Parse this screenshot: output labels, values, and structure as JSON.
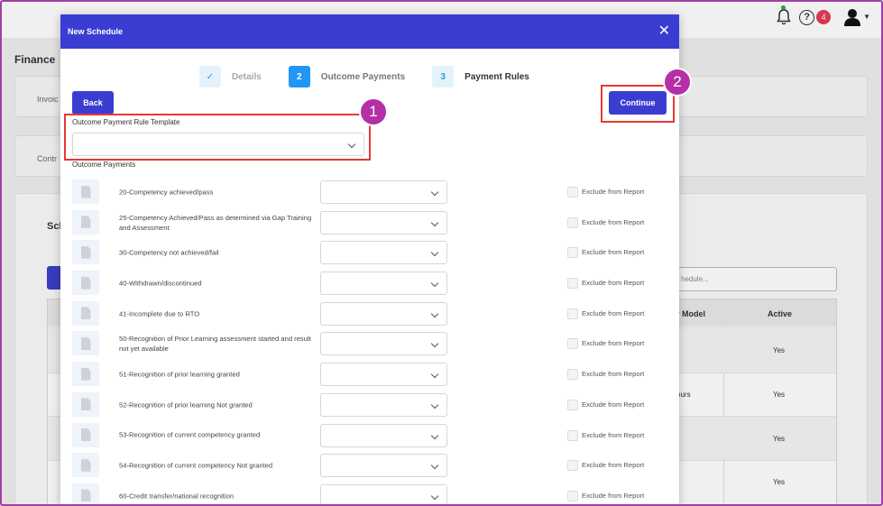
{
  "topbar": {
    "notification_count": "4",
    "help_glyph": "?",
    "icons": [
      "bell-icon",
      "help-icon",
      "user-icon",
      "caret-down-icon"
    ]
  },
  "background": {
    "page_title": "Finance",
    "card1_label": "Invoic",
    "card2_label": "Contr",
    "section_title": "Sch",
    "search_placeholder": "hedule...",
    "table_headers": {
      "model": "r Model",
      "active": "Active"
    },
    "table_rows": [
      {
        "model": "",
        "active": "Yes"
      },
      {
        "model": "ours",
        "active": "Yes"
      },
      {
        "model": "",
        "active": "Yes"
      },
      {
        "model": "",
        "active": "Yes"
      }
    ]
  },
  "modal": {
    "title": "New Schedule",
    "close_glyph": "✕",
    "steps": [
      {
        "num": "✓",
        "label": "Details",
        "state": "done"
      },
      {
        "num": "2",
        "label": "Outcome Payments",
        "state": "active"
      },
      {
        "num": "3",
        "label": "Payment Rules",
        "state": "next"
      }
    ],
    "back_label": "Back",
    "continue_label": "Continue",
    "template_label": "Outcome Payment Rule Template",
    "template_value": "",
    "outcome_payments_label": "Outcome Payments",
    "exclude_label": "Exclude from Report",
    "rows": [
      {
        "label": "20-Competency achieved/pass"
      },
      {
        "label": "25-Competency Achieved/Pass as determined via Gap Training and Assessment"
      },
      {
        "label": "30-Competency not achieved/fail"
      },
      {
        "label": "40-Withdrawn/discontinued"
      },
      {
        "label": "41-Incomplete due to RTO"
      },
      {
        "label": "50-Recognition of Prior Learning assessment started and result not yet available"
      },
      {
        "label": "51-Recognition of prior learning granted"
      },
      {
        "label": "52-Recognition of prior learning Not granted"
      },
      {
        "label": "53-Recognition of current competency granted"
      },
      {
        "label": "54-Recognition of current competency Not granted"
      },
      {
        "label": "60-Credit transfer/national recognition"
      }
    ]
  },
  "annotations": {
    "badge1": "1",
    "badge2": "2",
    "highlight_color": "#e53935",
    "badge_color": "#b52fa7"
  },
  "colors": {
    "primary": "#3b3dd2",
    "step_active": "#2196f3",
    "frame": "#a23fa8"
  }
}
